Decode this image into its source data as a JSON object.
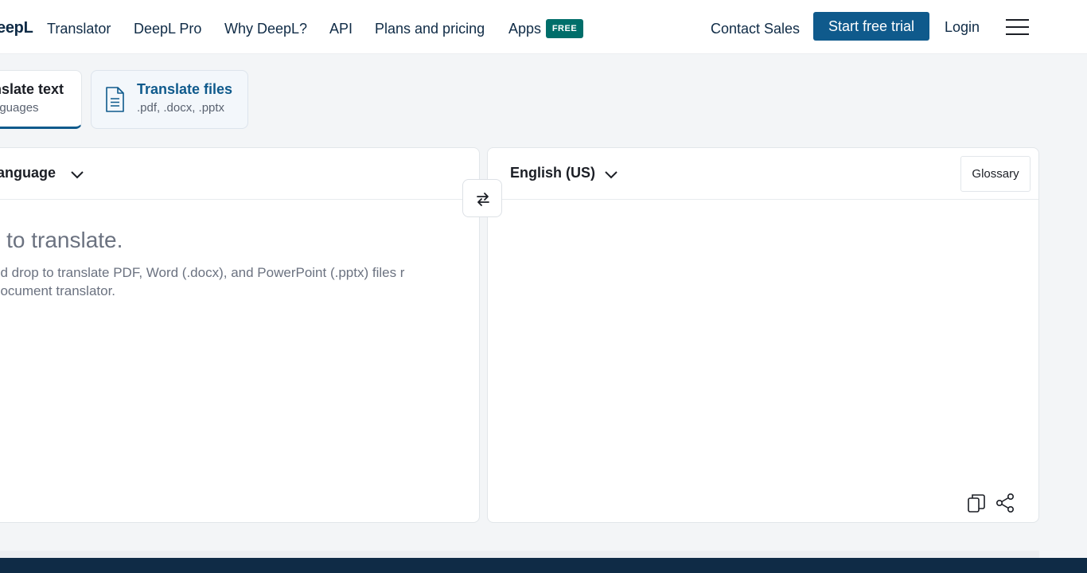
{
  "header": {
    "logo_text": "eepL",
    "logo_sub": "Translator",
    "nav": [
      {
        "label": "DeepL Pro"
      },
      {
        "label": "Why DeepL?"
      },
      {
        "label": "API"
      },
      {
        "label": "Plans and pricing"
      },
      {
        "label": "Apps"
      }
    ],
    "apps_badge": "FREE",
    "contact_sales": "Contact Sales",
    "cta_label": "Start free trial",
    "login": "Login",
    "menu_icon": "hamburger-icon"
  },
  "modes": {
    "text": {
      "title": "nslate text",
      "subtitle": "nguages"
    },
    "files": {
      "title": "Translate files",
      "subtitle": ".pdf, .docx, .pptx",
      "icon": "document-icon"
    }
  },
  "source_panel": {
    "language": "language",
    "placeholder": "- to translate.",
    "hint": "nd drop to translate PDF, Word (.docx), and PowerPoint (.pptx) files r document translator."
  },
  "swap": {
    "icon": "swap-arrows-icon"
  },
  "target_panel": {
    "language": "English (US)",
    "glossary": "Glossary",
    "copy_icon": "copy-icon",
    "share_icon": "share-icon"
  },
  "colors": {
    "brand_navy": "#0f2b46",
    "cta_blue": "#0f5a8c",
    "badge_teal": "#006e6a",
    "background": "#f3f5f7"
  }
}
